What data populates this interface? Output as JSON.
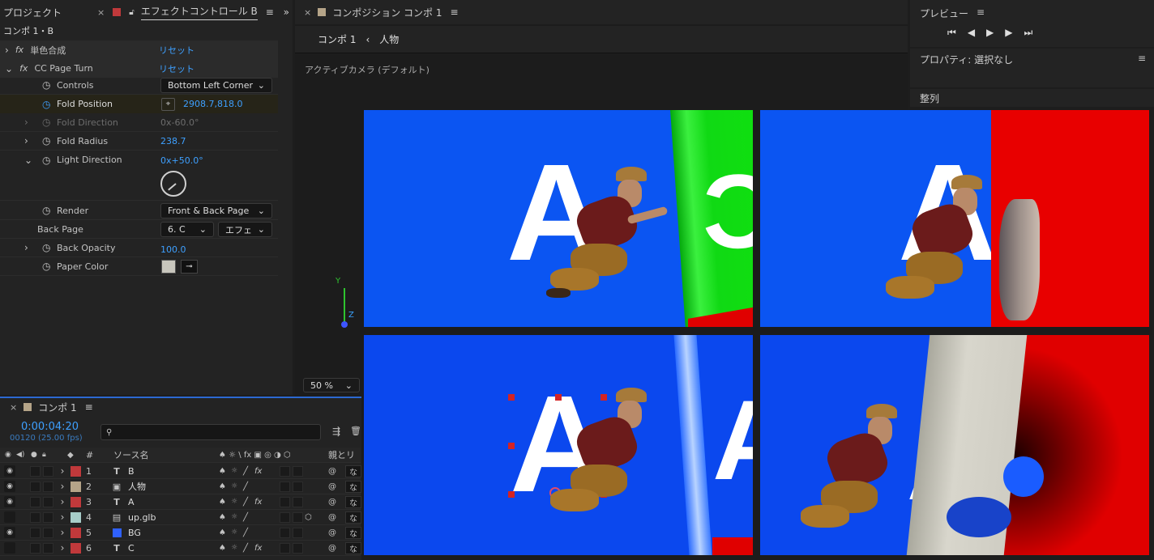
{
  "project_panel": {
    "tab_label": "プロジェクト",
    "effect_tab_label": "エフェクトコントロール B",
    "breadcrumb": "コンポ 1・B"
  },
  "effects": {
    "mono": {
      "name": "単色合成",
      "reset": "リセット"
    },
    "page_turn": {
      "name": "CC Page Turn",
      "reset": "リセット"
    },
    "controls": {
      "label": "Controls",
      "value": "Bottom Left Corner"
    },
    "fold_position": {
      "label": "Fold Position",
      "value": "2908.7,818.0"
    },
    "fold_direction": {
      "label": "Fold Direction",
      "value": "0x-60.0°"
    },
    "fold_radius": {
      "label": "Fold Radius",
      "value": "238.7"
    },
    "light_direction": {
      "label": "Light Direction",
      "value": "0x+50.0°"
    },
    "render": {
      "label": "Render",
      "value": "Front & Back Page"
    },
    "back_page": {
      "label": "Back Page",
      "value": "6. C",
      "value2": "エフェ"
    },
    "back_opacity": {
      "label": "Back Opacity",
      "value": "100.0"
    },
    "paper_color": {
      "label": "Paper Color",
      "swatch": "#c8c6bd"
    }
  },
  "composition_panel": {
    "tab_label": "コンポジション コンポ 1",
    "crumb_comp": "コンポ 1",
    "crumb_layer": "人物",
    "view_label": "アクティブカメラ (デフォルト)",
    "zoom": "50 %",
    "axis_y": "Y",
    "axis_z": "Z",
    "axis_x": "X",
    "view_letters": {
      "top_left": "A",
      "top_left_edge": "C",
      "top_right": "A",
      "bottom_left": "A",
      "bottom_left_edge": "A",
      "bottom_right": "A"
    }
  },
  "preview_panel": {
    "title": "プレビュー"
  },
  "properties_panel": {
    "title": "プロパティ: 選択なし"
  },
  "align_panel": {
    "title": "整列"
  },
  "timeline": {
    "tab_label": "コンポ 1",
    "timecode": "0:00:04:20",
    "frames": "00120 (25.00 fps)",
    "search_placeholder": "",
    "header_num": "#",
    "header_source": "ソース名",
    "header_switches": "♠ ☼ \\ fx ▣ ◎ ◑ ⬡",
    "header_parent": "親とリ",
    "layers": [
      {
        "num": "1",
        "type": "T",
        "name": "B",
        "color": "#c0393b",
        "eye": true,
        "fx": true
      },
      {
        "num": "2",
        "type": "img",
        "name": "人物",
        "color": "#b5a488",
        "eye": true,
        "fx": false
      },
      {
        "num": "3",
        "type": "T",
        "name": "A",
        "color": "#c0393b",
        "eye": true,
        "fx": true
      },
      {
        "num": "4",
        "type": "file",
        "name": "up.glb",
        "color": "#a7cdc8",
        "eye": false,
        "fx": false
      },
      {
        "num": "5",
        "type": "solid",
        "name": "BG",
        "color": "#c0393b",
        "eye": true,
        "fx": false
      },
      {
        "num": "6",
        "type": "T",
        "name": "C",
        "color": "#c0393b",
        "eye": false,
        "fx": true
      }
    ],
    "parent_stub": "な"
  }
}
